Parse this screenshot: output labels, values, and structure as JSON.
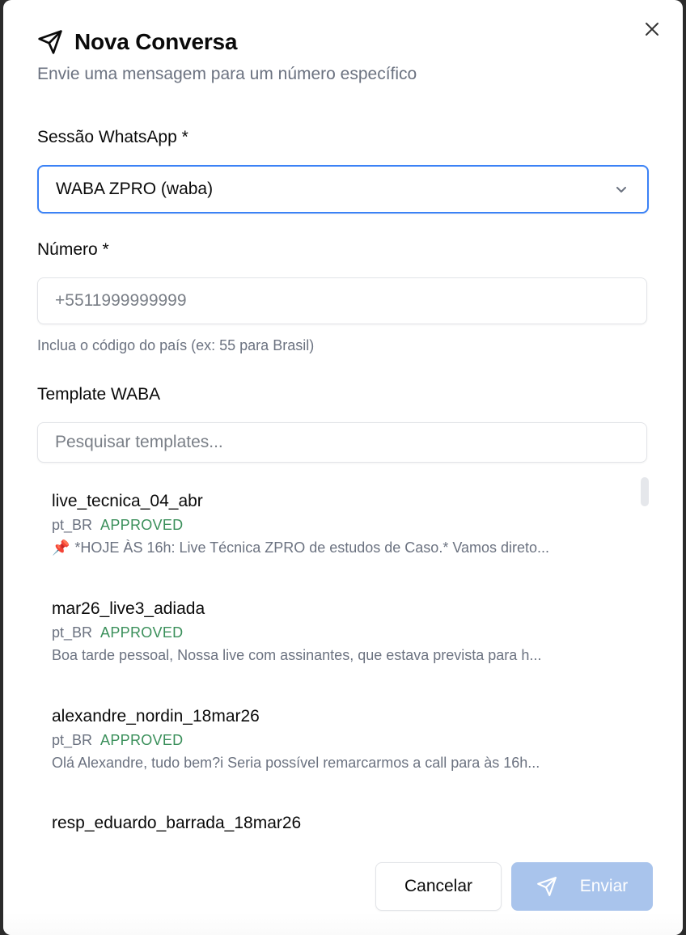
{
  "dialog": {
    "title": "Nova Conversa",
    "subtitle": "Envie uma mensagem para um número específico",
    "title_icon": "send-icon",
    "close_icon": "close-icon"
  },
  "session": {
    "label": "Sessão WhatsApp *",
    "selected": "WABA ZPRO (waba)",
    "icon": "chevron-down-icon"
  },
  "number": {
    "label": "Número *",
    "placeholder": "+5511999999999",
    "value": "",
    "hint": "Inclua o código do país (ex: 55 para Brasil)"
  },
  "templates": {
    "label": "Template WABA",
    "search_placeholder": "Pesquisar templates...",
    "items": [
      {
        "name": "live_tecnica_04_abr",
        "language": "pt_BR",
        "status": "APPROVED",
        "icon": "pushpin-icon",
        "preview": "*HOJE ÀS 16h: Live Técnica ZPRO de estudos de Caso.* Vamos direto..."
      },
      {
        "name": "mar26_live3_adiada",
        "language": "pt_BR",
        "status": "APPROVED",
        "preview": "Boa tarde pessoal, Nossa live com assinantes, que estava prevista para h..."
      },
      {
        "name": "alexandre_nordin_18mar26",
        "language": "pt_BR",
        "status": "APPROVED",
        "preview": "Olá Alexandre, tudo bem?i Seria possível remarcarmos a call para às 16h..."
      },
      {
        "name": "resp_eduardo_barrada_18mar26"
      }
    ]
  },
  "footer": {
    "cancel_label": "Cancelar",
    "send_label": "Enviar",
    "send_icon": "send-icon"
  },
  "colors": {
    "focus_border": "#3b82f6",
    "approved": "#3a8f5a",
    "send_disabled": "#a9c4ec",
    "muted_text": "#6b7280"
  }
}
